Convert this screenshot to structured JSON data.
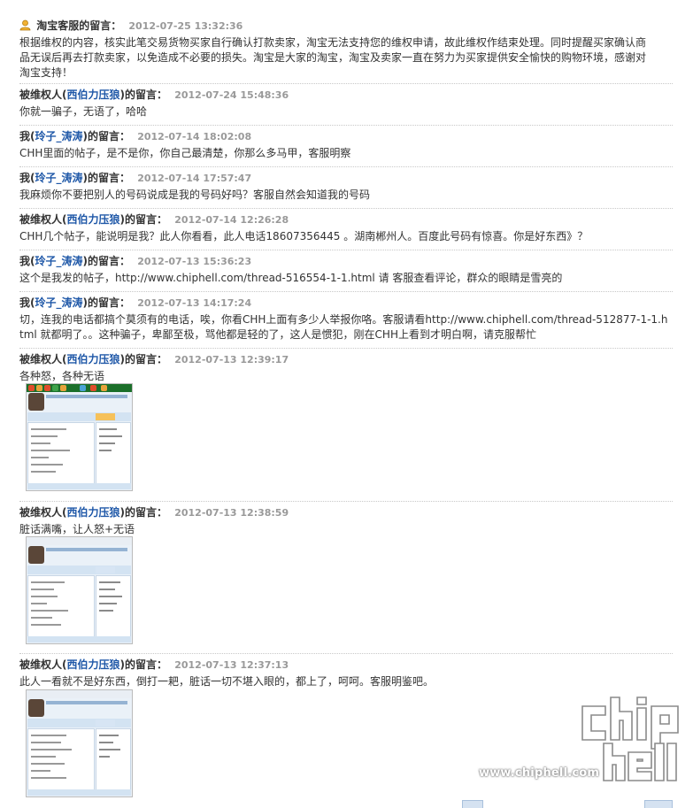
{
  "messages": [
    {
      "prefix": "",
      "name": "淘宝客服",
      "suffix": "的留言：",
      "time": "2012-07-25 13:32:36",
      "body": "根据维权的内容，核实此笔交易货物买家自行确认打款卖家，淘宝无法支持您的维权申请，故此维权作结束处理。同时提醒买家确认商\n品无误后再去打款卖家，以免造成不必要的损失。淘宝是大家的淘宝，淘宝及卖家一直在努力为买家提供安全愉快的购物环境，感谢对\n淘宝支持！"
    },
    {
      "prefix": "被维权人(",
      "name": "西伯力压狼",
      "suffix": ")的留言：",
      "time": "2012-07-24 15:48:36",
      "body": "你就一骗子，无语了，哈哈"
    },
    {
      "prefix": "我(",
      "name": "玲子_涛涛",
      "suffix": ")的留言：",
      "time": "2012-07-14 18:02:08",
      "body": "CHH里面的帖子，是不是你，你自己最清楚，你那么多马甲，客服明察"
    },
    {
      "prefix": "我(",
      "name": "玲子_涛涛",
      "suffix": ")的留言：",
      "time": "2012-07-14 17:57:47",
      "body": "我麻烦你不要把别人的号码说成是我的号码好吗？客服自然会知道我的号码"
    },
    {
      "prefix": "被维权人(",
      "name": "西伯力压狼",
      "suffix": ")的留言：",
      "time": "2012-07-14 12:26:28",
      "body": "CHH几个帖子，能说明是我？此人你看看，此人电话18607356445 。湖南郴州人。百度此号码有惊喜。你是好东西》？"
    },
    {
      "prefix": "我(",
      "name": "玲子_涛涛",
      "suffix": ")的留言：",
      "time": "2012-07-13 15:36:23",
      "body": "这个是我发的帖子，http://www.chiphell.com/thread-516554-1-1.html 请 客服查看评论，群众的眼睛是雪亮的"
    },
    {
      "prefix": "我(",
      "name": "玲子_涛涛",
      "suffix": ")的留言：",
      "time": "2012-07-13 14:17:24",
      "body": "切，连我的电话都搞个莫须有的电话，唉，你看CHH上面有多少人举报你咯。客服请看http://www.chiphell.com/thread-512877-1-1.h\ntml 就都明了。。这种骗子，卑鄙至极，骂他都是轻的了，这人是惯犯，刚在CHH上看到才明白啊，请克服帮忙"
    },
    {
      "prefix": "被维权人(",
      "name": "西伯力压狼",
      "suffix": ")的留言：",
      "time": "2012-07-13 12:39:17",
      "body": "各种怒，各种无语"
    },
    {
      "prefix": "被维权人(",
      "name": "西伯力压狼",
      "suffix": ")的留言：",
      "time": "2012-07-13 12:38:59",
      "body": "脏话满嘴，让人怒+无语"
    },
    {
      "prefix": "被维权人(",
      "name": "西伯力压狼",
      "suffix": ")的留言：",
      "time": "2012-07-13 12:37:13",
      "body": "此人一看就不是好东西，倒打一耙，脏话一切不堪入眼的，都上了，呵呵。客服明鉴吧。"
    }
  ],
  "watermark": {
    "url": "www.chiphell.com"
  },
  "colors": {
    "name_link": "#1f58a8",
    "timestamp": "#999999",
    "text": "#333333",
    "separator": "#c8c8c8"
  },
  "icons": {
    "service_avatar": "person-icon",
    "attachment": "screenshot-thumbnail"
  }
}
